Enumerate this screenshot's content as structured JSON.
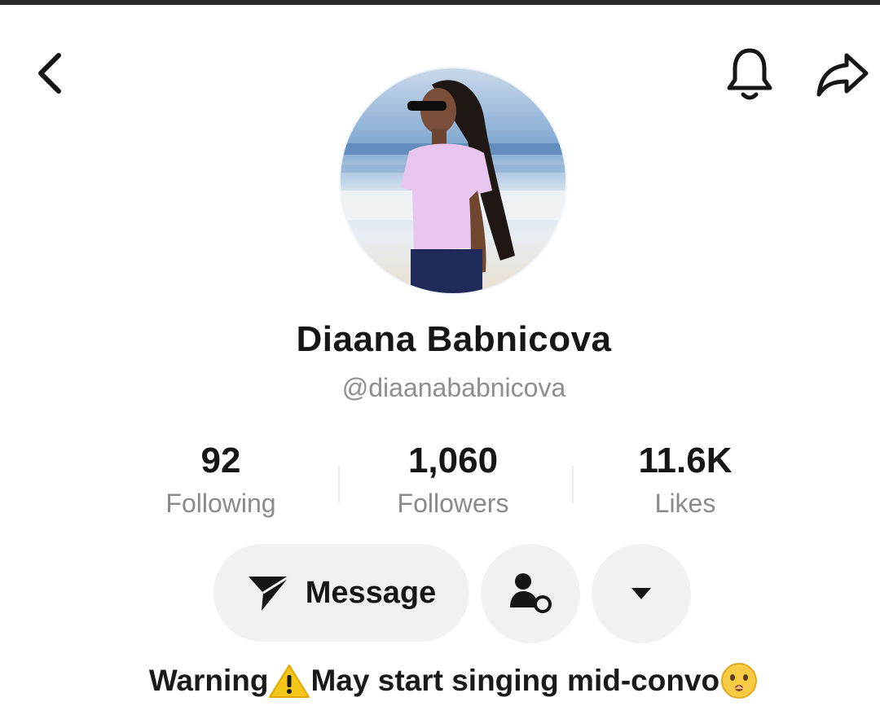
{
  "header": {
    "back_icon": "chevron-left-icon",
    "notification_icon": "bell-icon",
    "share_icon": "share-arrow-icon"
  },
  "profile": {
    "display_name": "Diaana Babnicova",
    "username": "@diaanababnicova",
    "avatar": "profile-photo-beach"
  },
  "stats": [
    {
      "value": "92",
      "label": "Following"
    },
    {
      "value": "1,060",
      "label": "Followers"
    },
    {
      "value": "11.6K",
      "label": "Likes"
    }
  ],
  "actions": {
    "message_label": "Message",
    "message_icon": "send-icon",
    "friend_icon": "person-add-icon",
    "more_icon": "caret-down-icon"
  },
  "bio": {
    "part1": "Warning",
    "part2": "May start singing mid-convo",
    "warning_icon": "warning-icon",
    "emoji_icon": "shushing-face-icon"
  },
  "colors": {
    "button_bg": "#f1f1f1",
    "text_primary": "#161616",
    "text_secondary": "#8a8a8a",
    "warning_yellow": "#f5c518"
  }
}
